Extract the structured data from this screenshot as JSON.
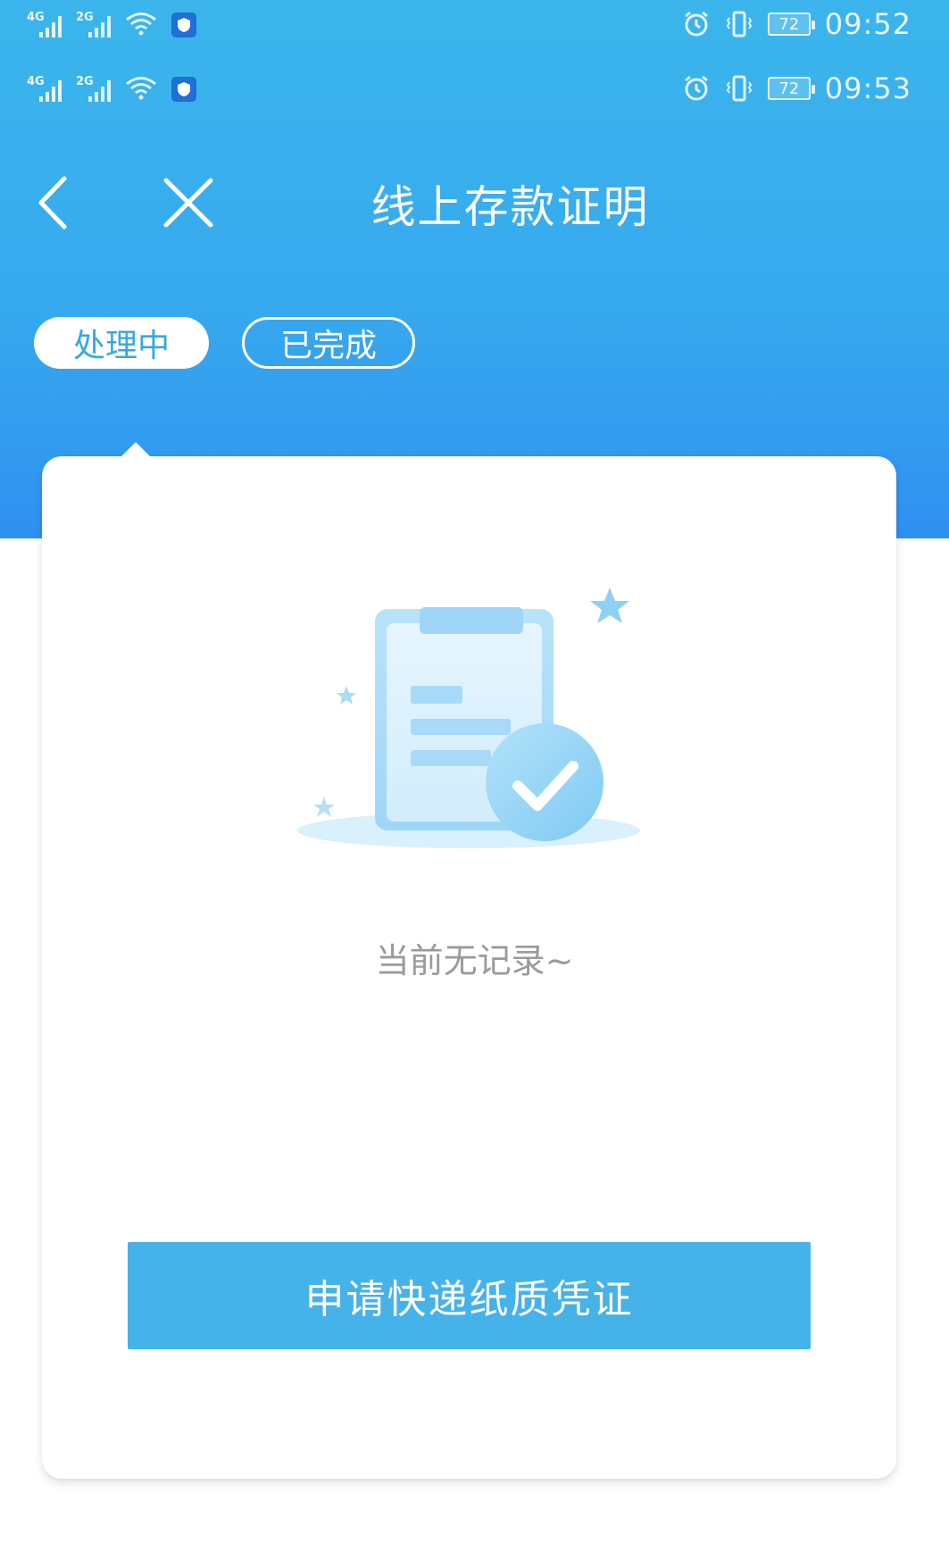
{
  "status_bars": [
    {
      "sim1": "4G",
      "sim2": "2G",
      "battery": "72",
      "time": "09:52"
    },
    {
      "sim1": "4G",
      "sim2": "2G",
      "battery": "72",
      "time": "09:53"
    }
  ],
  "navbar": {
    "title": "线上存款证明",
    "back_icon": "chevron-left-icon",
    "close_icon": "close-icon"
  },
  "tabs": [
    {
      "label": "处理中",
      "active": true
    },
    {
      "label": "已完成",
      "active": false
    }
  ],
  "empty_state": {
    "icon": "clipboard-check-icon",
    "message": "当前无记录~"
  },
  "actions": {
    "apply_label": "申请快递纸质凭证"
  },
  "colors": {
    "header_top": "#3bb5ec",
    "header_bottom": "#2f90f0",
    "accent": "#33a8e6",
    "button": "#45b2ea",
    "muted_text": "#9a9a9a"
  }
}
